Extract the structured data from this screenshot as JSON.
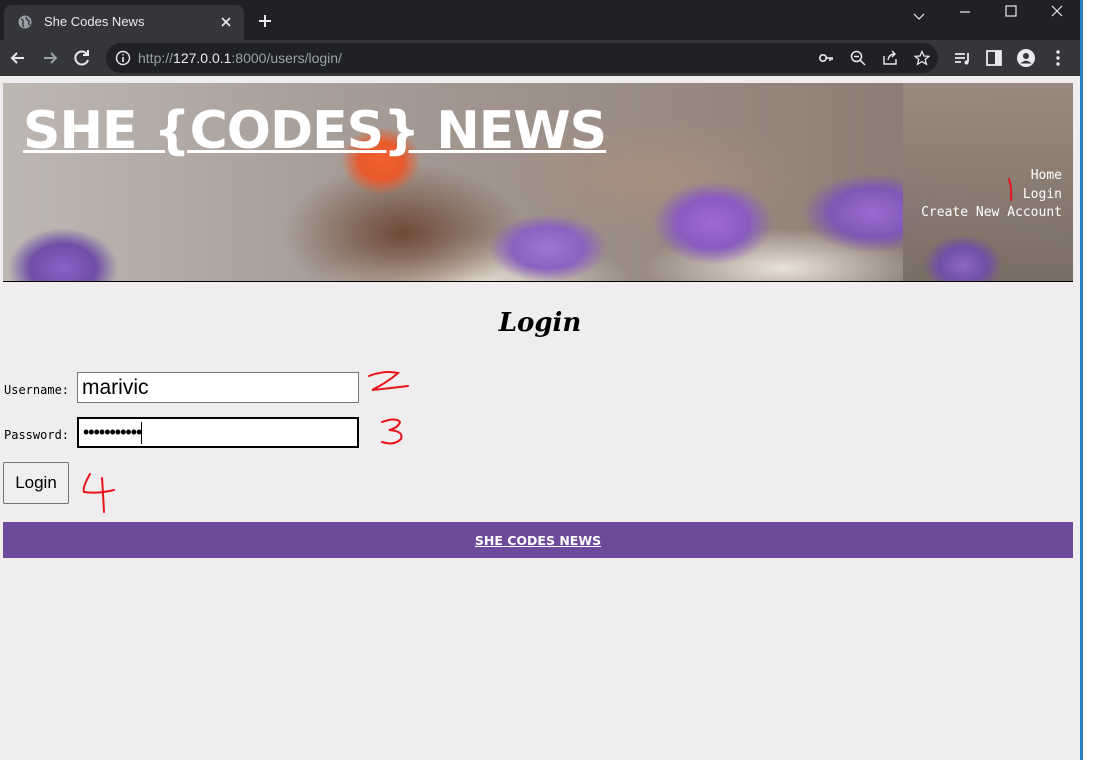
{
  "browser": {
    "tab_title": "She Codes News",
    "url_scheme": "http://",
    "url_host": "127.0.0.1",
    "url_rest": ":8000/users/login/"
  },
  "header": {
    "site_title": "SHE {CODES} NEWS",
    "nav": [
      {
        "label": "Home"
      },
      {
        "label": "Login"
      },
      {
        "label": "Create New Account"
      }
    ]
  },
  "login_form": {
    "heading": "Login",
    "username_label": "Username:",
    "username_value": "marivic",
    "password_label": "Password:",
    "password_value": "•••••••••••",
    "submit_label": "Login"
  },
  "footer": {
    "link": "SHE CODES NEWS"
  },
  "annotations": [
    "1",
    "2",
    "3",
    "4"
  ],
  "colors": {
    "page_bg": "#efedee",
    "footer_bg": "#6d4a9c",
    "annotation": "#e8141b",
    "chrome_bg": "#202124"
  },
  "icons": [
    "globe-icon",
    "close-icon",
    "plus-icon",
    "chevron-down-icon",
    "minimize-icon",
    "maximize-icon",
    "back-arrow-icon",
    "forward-arrow-icon",
    "reload-icon",
    "info-icon",
    "key-icon",
    "zoom-out-icon",
    "share-icon",
    "star-icon",
    "reading-list-icon",
    "side-panel-icon",
    "profile-icon",
    "more-icon"
  ]
}
